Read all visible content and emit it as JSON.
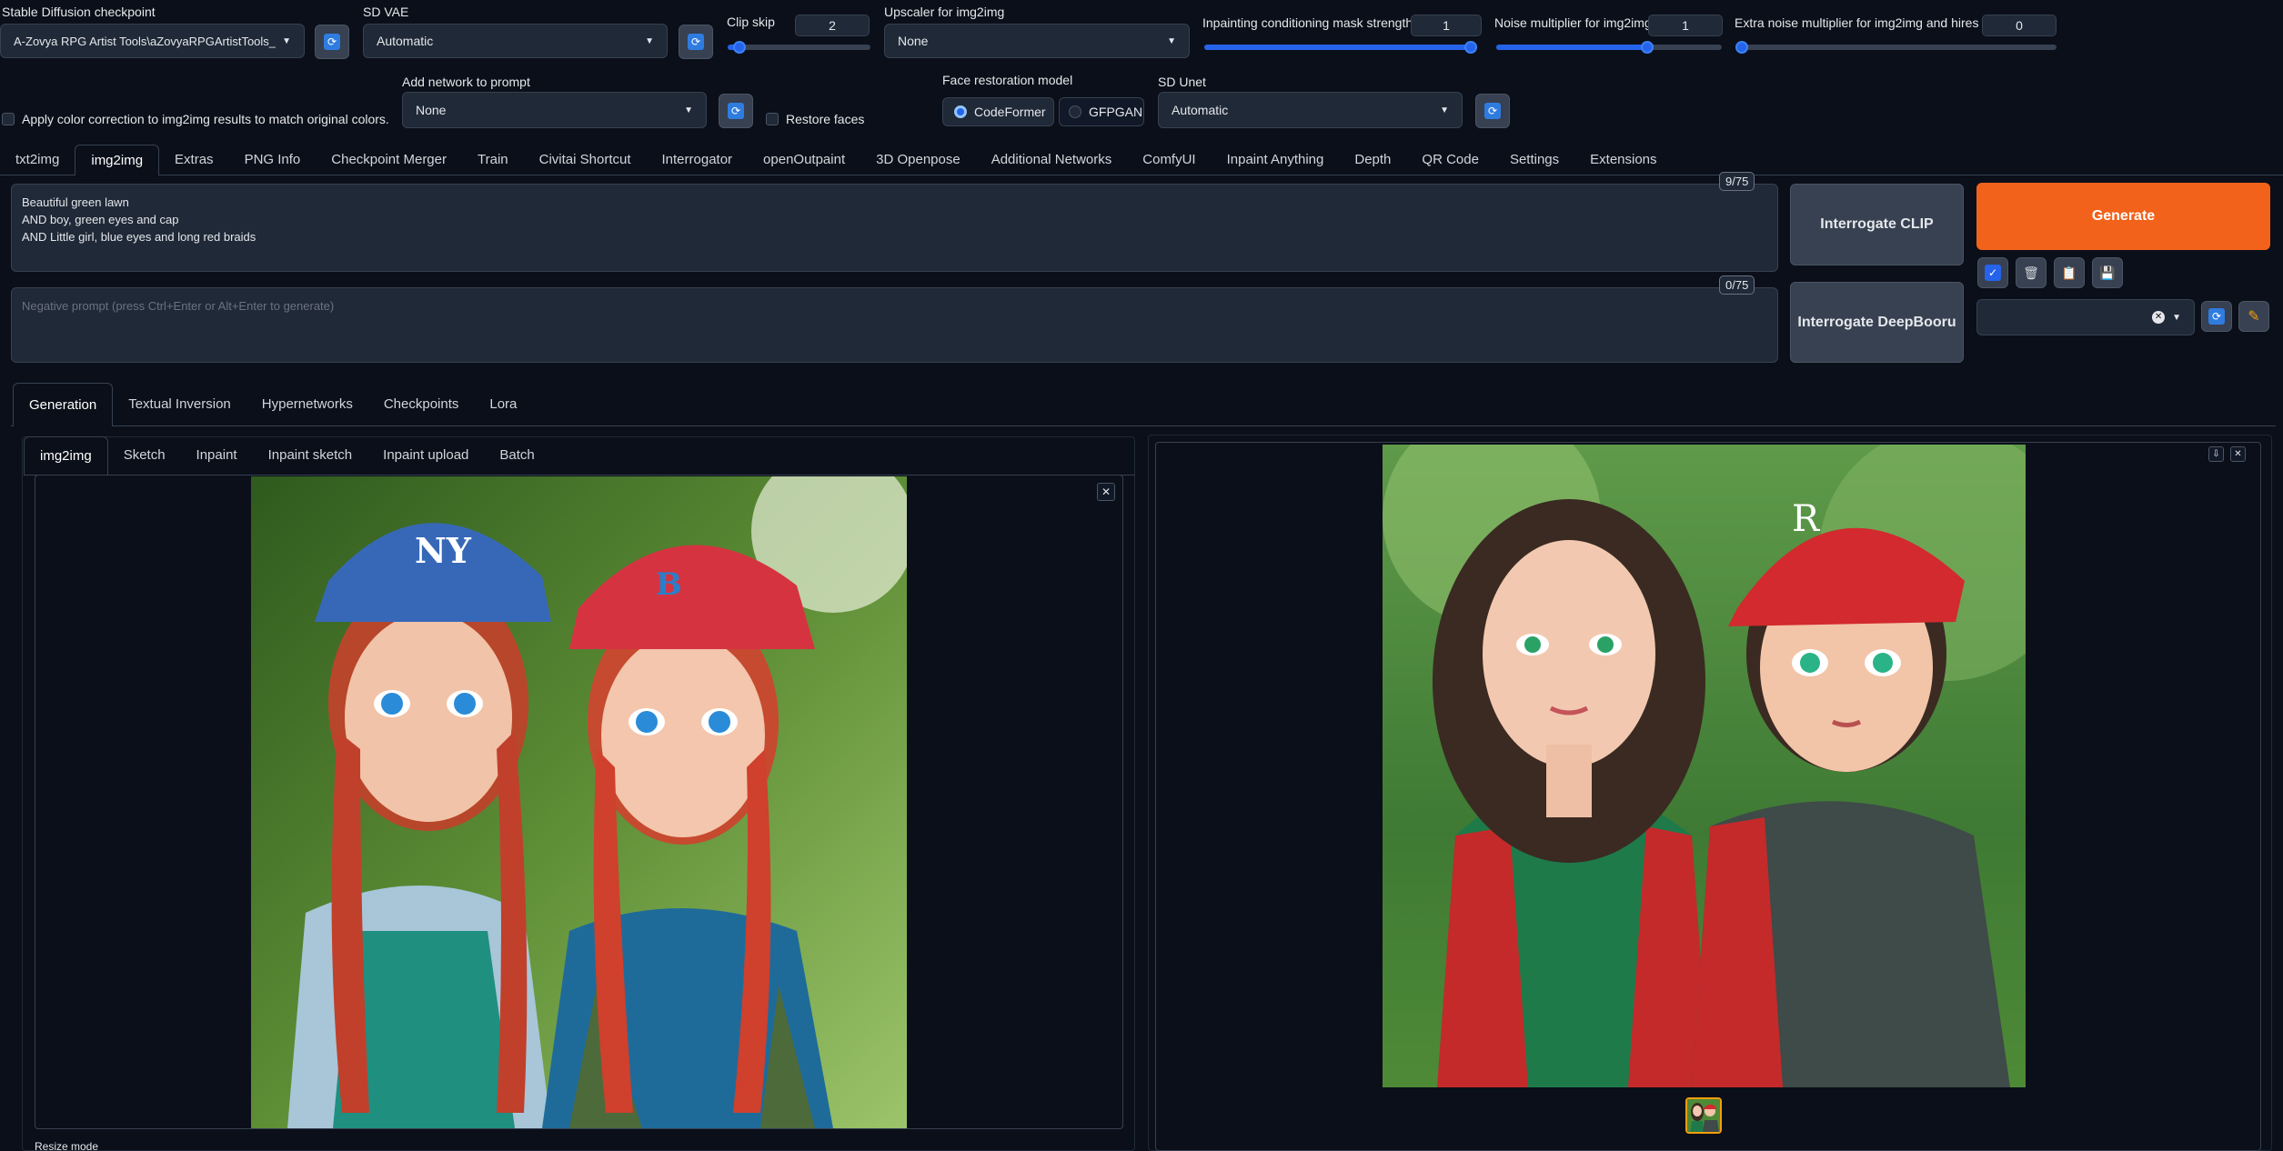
{
  "settings": {
    "checkpoint": {
      "label": "Stable Diffusion checkpoint",
      "value": "A-Zovya RPG Artist Tools\\aZovyaRPGArtistTools_"
    },
    "vae": {
      "label": "SD VAE",
      "value": "Automatic"
    },
    "clip_skip": {
      "label": "Clip skip",
      "value": "2"
    },
    "upscaler": {
      "label": "Upscaler for img2img",
      "value": "None"
    },
    "inpaint_mask_strength": {
      "label": "Inpainting conditioning mask strength",
      "value": "1",
      "level": 1.0
    },
    "noise_multiplier": {
      "label": "Noise multiplier for img2img",
      "value": "1",
      "level": 0.67
    },
    "extra_noise": {
      "label": "Extra noise multiplier for img2img and hires fix",
      "value": "0",
      "level": 0.0
    },
    "clip_skip_level": 0.08,
    "color_correction": {
      "label": "Apply color correction to img2img results to match original colors.",
      "checked": false
    },
    "add_network": {
      "label": "Add network to prompt",
      "value": "None"
    },
    "restore_faces": {
      "label": "Restore faces",
      "checked": false
    },
    "face_restoration": {
      "label": "Face restoration model",
      "options": [
        "CodeFormer",
        "GFPGAN"
      ],
      "selected": "CodeFormer"
    },
    "sd_unet": {
      "label": "SD Unet",
      "value": "Automatic"
    }
  },
  "main_tabs": [
    "txt2img",
    "img2img",
    "Extras",
    "PNG Info",
    "Checkpoint Merger",
    "Train",
    "Civitai Shortcut",
    "Interrogator",
    "openOutpaint",
    "3D Openpose",
    "Additional Networks",
    "ComfyUI",
    "Inpaint Anything",
    "Depth",
    "QR Code",
    "Settings",
    "Extensions"
  ],
  "main_tab_active": "img2img",
  "prompt": {
    "lines": [
      "Beautiful green lawn",
      "AND boy, green eyes and cap",
      "AND Little girl, blue eyes and long red braids"
    ],
    "token_count": "9/75"
  },
  "negative_prompt": {
    "placeholder": "Negative prompt (press Ctrl+Enter or Alt+Enter to generate)",
    "token_count": "0/75"
  },
  "buttons": {
    "interrogate_clip": "Interrogate CLIP",
    "interrogate_deepbooru": "Interrogate DeepBooru",
    "generate": "Generate"
  },
  "sub_tabs": [
    "Generation",
    "Textual Inversion",
    "Hypernetworks",
    "Checkpoints",
    "Lora"
  ],
  "sub_tab_active": "Generation",
  "img_tabs": [
    "img2img",
    "Sketch",
    "Inpaint",
    "Inpaint sketch",
    "Inpaint upload",
    "Batch"
  ],
  "img_tab_active": "img2img",
  "resize_label": "Resize mode",
  "colors": {
    "background": "#0b0f19",
    "generate": "#f2621a",
    "accent": "#2563eb"
  },
  "icons": {
    "refresh": "refresh-icon",
    "close": "close-icon",
    "download": "download-icon",
    "trash": "trash-icon",
    "clipboard": "clipboard-icon",
    "save": "save-icon",
    "pencil": "pencil-icon",
    "check": "check-icon"
  }
}
